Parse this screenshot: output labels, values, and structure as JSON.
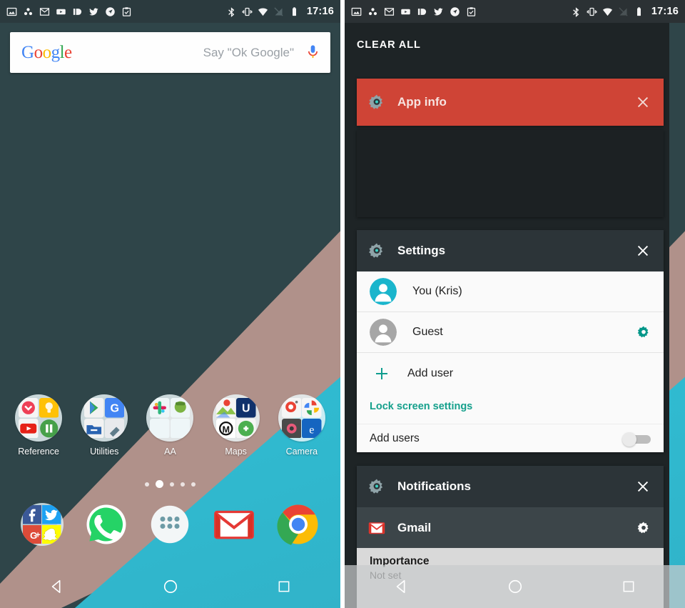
{
  "status_bar": {
    "time": "17:16",
    "left_icons": [
      "screenshot-icon",
      "google-drive-icon",
      "gmail-icon",
      "youtube-icon",
      "pocket-casts-icon",
      "twitter-icon",
      "navigation-arrow-icon",
      "clipboard-icon"
    ],
    "right_icons": [
      "bluetooth-icon",
      "vibrate-icon",
      "wifi-icon",
      "no-signal-icon",
      "battery-icon"
    ]
  },
  "home_screen": {
    "search": {
      "logo_letters": [
        {
          "char": "G",
          "color": "#4285f4"
        },
        {
          "char": "o",
          "color": "#ea4335"
        },
        {
          "char": "o",
          "color": "#fbbc05"
        },
        {
          "char": "g",
          "color": "#4285f4"
        },
        {
          "char": "l",
          "color": "#34a853"
        },
        {
          "char": "e",
          "color": "#ea4335"
        }
      ],
      "placeholder": "Say \"Ok Google\"",
      "mic_icon": "microphone-icon"
    },
    "folders": [
      {
        "label": "Reference"
      },
      {
        "label": "Utilities"
      },
      {
        "label": "AA"
      },
      {
        "label": "Maps"
      },
      {
        "label": "Camera"
      }
    ],
    "page_dots": {
      "count": 5,
      "active_index": 1
    },
    "dock": [
      {
        "name": "social-folder"
      },
      {
        "name": "whatsapp"
      },
      {
        "name": "app-drawer"
      },
      {
        "name": "gmail"
      },
      {
        "name": "chrome"
      }
    ],
    "nav_bar": {
      "back": "back-triangle-icon",
      "home": "home-circle-icon",
      "recents": "recents-square-icon"
    }
  },
  "notification_shade": {
    "clear_all_label": "CLEAR ALL",
    "cards": [
      {
        "id": "app-info",
        "title": "App info",
        "icon": "settings-gear-icon",
        "close_icon": "close-icon",
        "background": "#cf4436"
      },
      {
        "id": "settings",
        "title": "Settings",
        "icon": "settings-gear-icon",
        "close_icon": "close-icon",
        "users": [
          {
            "name": "You (Kris)",
            "avatar": "user-avatar-teal",
            "has_gear": false
          },
          {
            "name": "Guest",
            "avatar": "user-avatar-grey",
            "has_gear": true
          }
        ],
        "add_user_label": "Add user",
        "add_user_icon": "plus-icon",
        "lock_screen_link": "Lock screen settings",
        "add_users_label": "Add users",
        "add_users_toggle": "off"
      },
      {
        "id": "notifications",
        "title": "Notifications",
        "icon": "settings-gear-icon",
        "close_icon": "close-icon",
        "app_row": {
          "app": "Gmail",
          "icon": "gmail-icon",
          "gear": "settings-gear-icon"
        },
        "importance_title": "Importance",
        "importance_value": "Not set"
      }
    ],
    "nav_bar": {
      "back": "back-triangle-icon",
      "home": "home-circle-icon",
      "recents": "recents-square-icon"
    }
  },
  "colors": {
    "wallpaper_dark": "#2f4549",
    "wallpaper_tan": "#b0918a",
    "wallpaper_cyan": "#2cc6dd",
    "status_bar": "#2b3a3e",
    "shade_bg": "#1e2426",
    "card_header": "#2c3438",
    "accent_red": "#cf4436",
    "accent_teal": "#15a08c",
    "avatar_teal": "#1ab5cc"
  }
}
